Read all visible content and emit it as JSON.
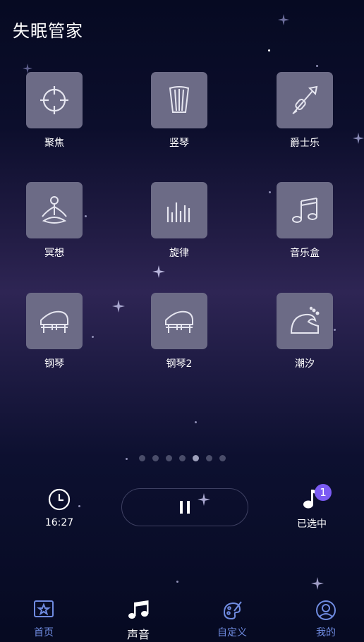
{
  "header": {
    "title": "失眠管家"
  },
  "sounds": [
    {
      "label": "聚焦",
      "icon": "crosshair-icon"
    },
    {
      "label": "竖琴",
      "icon": "harp-icon"
    },
    {
      "label": "爵士乐",
      "icon": "trumpet-icon"
    },
    {
      "label": "冥想",
      "icon": "meditation-icon"
    },
    {
      "label": "旋律",
      "icon": "equalizer-bars-icon"
    },
    {
      "label": "音乐盒",
      "icon": "music-note-icon"
    },
    {
      "label": "钢琴",
      "icon": "grand-piano-icon"
    },
    {
      "label": "钢琴2",
      "icon": "grand-piano-icon"
    },
    {
      "label": "潮汐",
      "icon": "wave-icon"
    }
  ],
  "pager": {
    "total": 7,
    "active_index": 4
  },
  "controls": {
    "timer_value": "16:27",
    "selected_label": "已选中",
    "selected_count": "1"
  },
  "nav": {
    "items": [
      {
        "label": "首页",
        "icon": "home-star-icon"
      },
      {
        "label": "声音",
        "icon": "music-notes-icon",
        "active": true
      },
      {
        "label": "自定义",
        "icon": "palette-icon"
      },
      {
        "label": "我的",
        "icon": "profile-icon"
      }
    ]
  },
  "colors": {
    "accent_nav": "#6f8be0",
    "badge": "#7b5bf3",
    "tile": "#6c6b86"
  }
}
